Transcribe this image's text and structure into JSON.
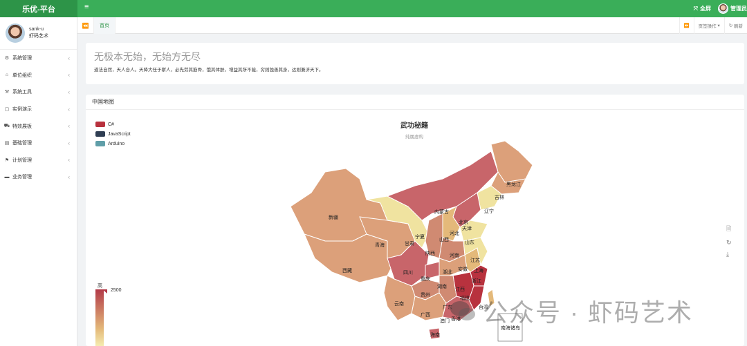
{
  "brand": "乐优-平台",
  "topbar": {
    "menu_icon": "hamburger-icon",
    "fullscreen_label": "全屏",
    "admin_label": "管理员"
  },
  "user": {
    "name": "sank-u",
    "subtitle": "虾码艺术"
  },
  "sidebar": {
    "items": [
      {
        "label": "系统管理",
        "icon": "gear-icon"
      },
      {
        "label": "单位组织",
        "icon": "home-icon"
      },
      {
        "label": "系统工具",
        "icon": "tools-icon"
      },
      {
        "label": "实例演示",
        "icon": "window-icon"
      },
      {
        "label": "特效展板",
        "icon": "car-icon"
      },
      {
        "label": "基础管理",
        "icon": "server-icon"
      },
      {
        "label": "计划管理",
        "icon": "flag-icon"
      },
      {
        "label": "业务管理",
        "icon": "briefcase-icon"
      }
    ]
  },
  "tabs": {
    "home": "首页",
    "page_ops": "页签操作",
    "refresh": "刷新"
  },
  "welcome": {
    "title": "无极本无始，无始方无尽",
    "text": "道法自然，天人合人。天降大任于斯人，必先劳其筋骨，饿其体肤，增益其所不能，穷则独善其身，达则兼济天下。"
  },
  "map_card": {
    "header": "中国地图"
  },
  "chart_data": {
    "type": "map",
    "title": "武功秘籍",
    "subtitle": "纯属虚构",
    "series": [
      {
        "name": "C#",
        "color": "#b8323e"
      },
      {
        "name": "JavaScript",
        "color": "#2f3e53"
      },
      {
        "name": "Arduino",
        "color": "#5f9ea8"
      }
    ],
    "visual_map": {
      "high_label": "高",
      "max": 2500
    },
    "regions": [
      "黑龙江",
      "吉林",
      "辽宁",
      "内蒙古",
      "北京",
      "天津",
      "河北",
      "山西",
      "山东",
      "宁夏",
      "甘肃",
      "陕西",
      "河南",
      "新疆",
      "青海",
      "西藏",
      "四川",
      "重庆",
      "湖北",
      "安徽",
      "江苏",
      "上海",
      "浙江",
      "湖南",
      "江西",
      "贵州",
      "云南",
      "广西",
      "广东",
      "福建",
      "台湾",
      "澳门",
      "香港",
      "海南",
      "南海诸岛"
    ]
  },
  "watermark": "公众号 · 虾码艺术"
}
